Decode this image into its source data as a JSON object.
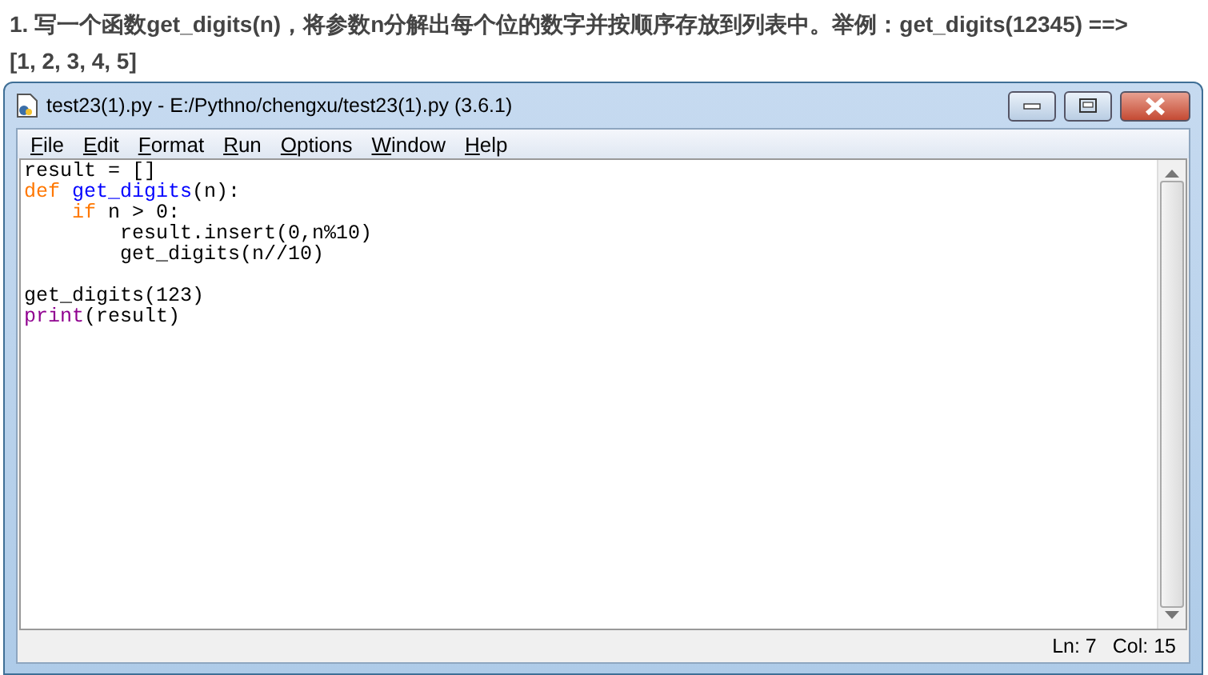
{
  "question": {
    "number": "1.",
    "text": "写一个函数**get_digits(n)**，将参数n分解出每个位的数字并按顺序存放到列表中。举例：**get_digits(12345) ==> [1, 2, 3, 4, 5]**"
  },
  "window": {
    "title": "test23(1).py - E:/Pythno/chengxu/test23(1).py (3.6.1)"
  },
  "menu": [
    "File",
    "Edit",
    "Format",
    "Run",
    "Options",
    "Window",
    "Help"
  ],
  "code_blocks": [
    [
      [
        {
          "text": "result = []",
          "kind": "plain"
        }
      ],
      [
        {
          "text": "def ",
          "kind": "keyword"
        },
        {
          "text": "get_digits",
          "kind": "definition"
        },
        {
          "text": "(n):",
          "kind": "plain"
        }
      ],
      [
        {
          "text": "    if",
          "kind": "keyword"
        },
        {
          "text": " n > 0:",
          "kind": "plain"
        }
      ],
      [
        {
          "text": "        result.insert(0,n%10)",
          "kind": "plain"
        }
      ],
      [
        {
          "text": "        get_digits(n//10)",
          "kind": "plain"
        }
      ]
    ],
    [
      [
        {
          "text": "get_digits(123)",
          "kind": "plain"
        }
      ],
      [
        {
          "text": "print",
          "kind": "builtin"
        },
        {
          "text": "(result)",
          "kind": "plain"
        }
      ]
    ]
  ],
  "status_bar": {
    "line": "Ln: 7",
    "column": "Col: 15"
  }
}
